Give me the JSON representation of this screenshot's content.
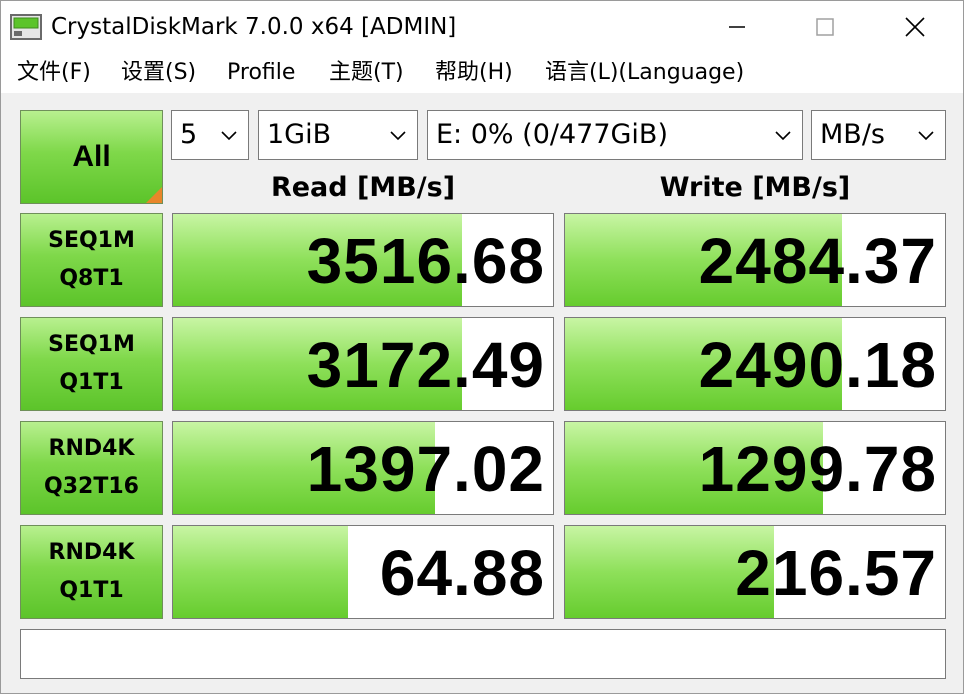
{
  "window": {
    "title": "CrystalDiskMark 7.0.0 x64 [ADMIN]"
  },
  "menu": [
    {
      "label": "文件(F)"
    },
    {
      "label": "设置(S)"
    },
    {
      "label": "Profile"
    },
    {
      "label": "主题(T)"
    },
    {
      "label": "帮助(H)"
    },
    {
      "label": "语言(L)(Language)"
    }
  ],
  "controls": {
    "all_label": "All",
    "count": "5",
    "size": "1GiB",
    "drive": "E: 0% (0/477GiB)",
    "unit": "MB/s"
  },
  "headers": {
    "read": "Read [MB/s]",
    "write": "Write [MB/s]"
  },
  "tests": [
    {
      "line1": "SEQ1M",
      "line2": "Q8T1",
      "read": "3516.68",
      "write": "2484.37",
      "read_fill": 0.76,
      "write_fill": 0.73
    },
    {
      "line1": "SEQ1M",
      "line2": "Q1T1",
      "read": "3172.49",
      "write": "2490.18",
      "read_fill": 0.76,
      "write_fill": 0.73
    },
    {
      "line1": "RND4K",
      "line2": "Q32T16",
      "read": "1397.02",
      "write": "1299.78",
      "read_fill": 0.69,
      "write_fill": 0.68
    },
    {
      "line1": "RND4K",
      "line2": "Q1T1",
      "read": "64.88",
      "write": "216.57",
      "read_fill": 0.46,
      "write_fill": 0.55
    }
  ],
  "status": "",
  "colors": {
    "accent_green": "#7fd84a",
    "corner_orange": "#e8862a"
  }
}
